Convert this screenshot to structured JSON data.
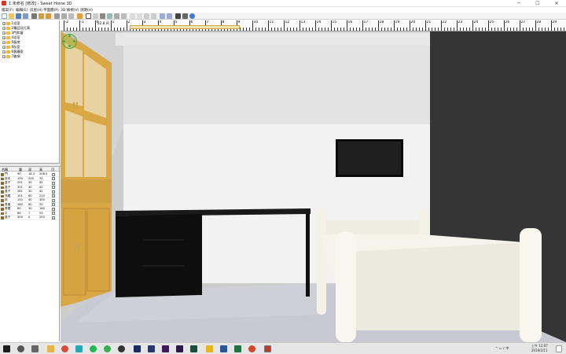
{
  "window": {
    "title": "1 未命名 [修改] - Sweet Home 3D",
    "minimize_glyph": "─",
    "maximize_glyph": "☐",
    "close_glyph": "✕"
  },
  "menu": [
    "檔案(F)",
    "編輯(E)",
    "房屋(H)",
    "平面圖(P)",
    "3D 檢視(V)",
    "說明(H)"
  ],
  "toolbar_icons": [
    "new-file-icon",
    "open-icon",
    "save-icon",
    "save-as-icon",
    "cut-icon",
    "undo-icon",
    "redo-icon",
    "cut-icon",
    "copy-icon",
    "paste-icon",
    "add-furniture-icon",
    "select-icon",
    "pan-icon",
    "create-walls-icon",
    "create-rooms-icon",
    "create-polylines-icon",
    "create-dimensions-icon",
    "add-text-icon",
    "text-style-icon",
    "zoom-in-icon",
    "zoom-out-icon",
    "photo-icon",
    "video-icon",
    "help-icon"
  ],
  "tree": [
    {
      "label": "1浴室"
    },
    {
      "label": "2電話及打表"
    },
    {
      "label": "3門和窗"
    },
    {
      "label": "4浴室"
    },
    {
      "label": "5廚房"
    },
    {
      "label": "6臥室"
    },
    {
      "label": "6客廳室"
    },
    {
      "label": "7雜項"
    }
  ],
  "furniture_table": {
    "headers": [
      "名稱",
      "寬",
      "深",
      "高",
      "可"
    ],
    "rows": [
      {
        "name": "門",
        "w": "90",
        "d": "18.3",
        "h": "208.5"
      },
      {
        "name": "床本",
        "w": "100",
        "d": "200",
        "h": "70"
      },
      {
        "name": "盒子",
        "w": "291",
        "d": "30",
        "h": "42"
      },
      {
        "name": "盒子",
        "w": "311",
        "d": "30",
        "h": "42"
      },
      {
        "name": "盒子",
        "w": "281",
        "d": "30",
        "h": "42"
      },
      {
        "name": "衣櫃",
        "w": "101",
        "d": "60",
        "h": "210"
      },
      {
        "name": "床",
        "w": "150",
        "d": "40",
        "h": "300"
      },
      {
        "name": "書桌",
        "w": "160",
        "d": "60",
        "h": "70"
      },
      {
        "name": "書櫃",
        "w": "60",
        "d": "30",
        "h": "160"
      },
      {
        "name": "平",
        "w": "84",
        "d": "7",
        "h": "53"
      },
      {
        "name": "盒子",
        "w": "300",
        "d": "0",
        "h": "150"
      }
    ]
  },
  "ruler": {
    "labels": [
      "-2",
      "-1",
      "0",
      "1",
      "2",
      "3",
      "4",
      "5",
      "6",
      "7",
      "8",
      "9",
      "10",
      "11",
      "12",
      "13",
      "14",
      "15",
      "16",
      "17",
      "18",
      "19",
      "20",
      "21",
      "22",
      "23",
      "24",
      "25",
      "26",
      "27",
      "28",
      "29"
    ],
    "selection_label": "22.8 尺"
  },
  "taskbar": {
    "time": "上午 12:07",
    "date": "2019/2/11"
  }
}
